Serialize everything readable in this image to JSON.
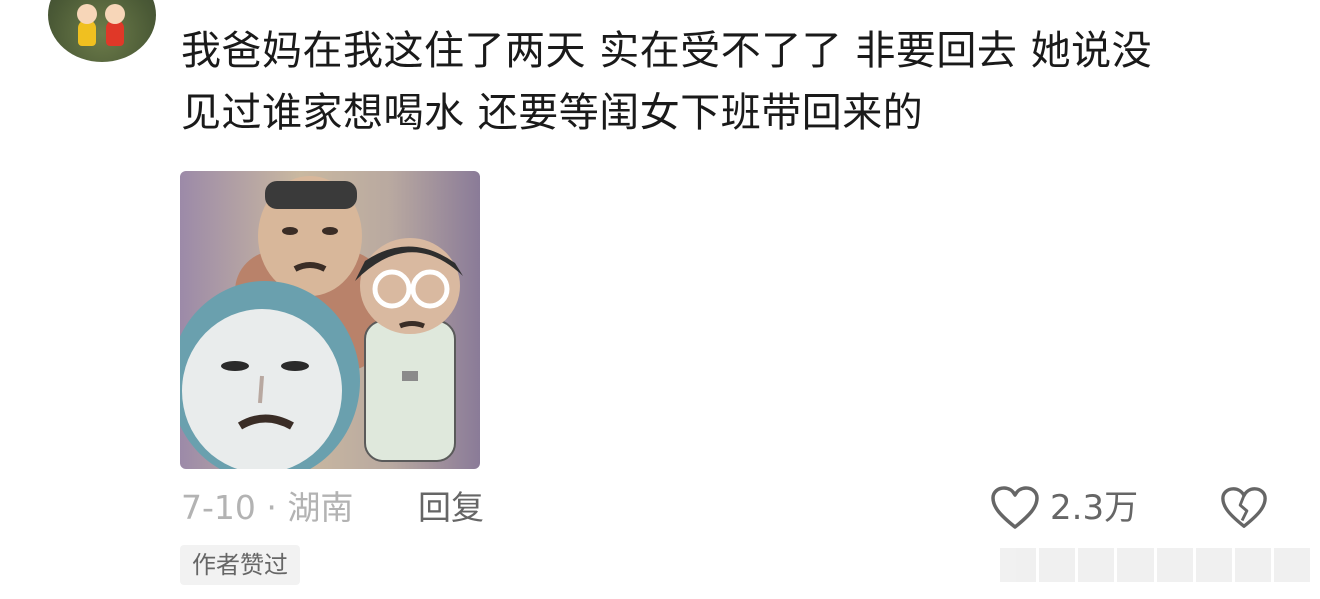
{
  "comment": {
    "text": "我爸妈在我这住了两天  实在受不了了  非要回去  她说没\n见过谁家想喝水  还要等闺女下班带回来的",
    "date_location": "7-10 · 湖南",
    "reply_label": "回复",
    "like_count": "2.3万",
    "author_badge": "作者赞过"
  },
  "icons": {
    "like": "heart-icon",
    "dislike": "broken-heart-icon"
  },
  "colors": {
    "text": "#1a1a1a",
    "meta": "#b3b3b3",
    "secondary": "#666666",
    "badge_bg": "#f2f2f2"
  }
}
